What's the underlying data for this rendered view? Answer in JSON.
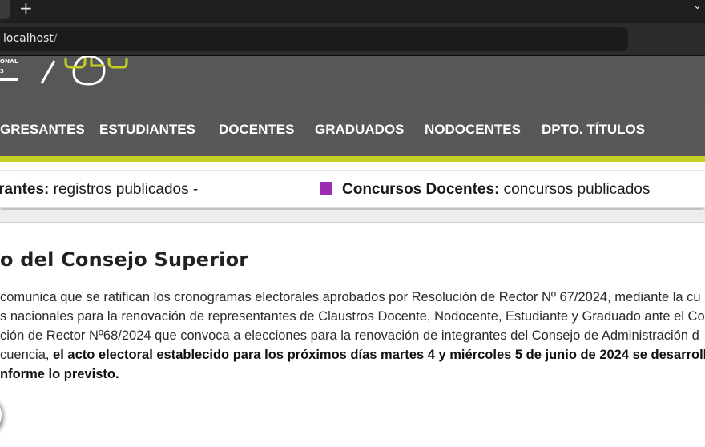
{
  "browser": {
    "new_tab_label": "+",
    "tab_list_label": "⌄",
    "url_host": "localhost",
    "url_path": "/"
  },
  "header": {
    "logo_line1": "ONAL",
    "logo_line2": "3",
    "logo_accent_color": "#c3cf21"
  },
  "nav": {
    "items": [
      {
        "label": "GRESANTES"
      },
      {
        "label": "ESTUDIANTES"
      },
      {
        "label": "DOCENTES"
      },
      {
        "label": "GRADUADOS"
      },
      {
        "label": "NODOCENTES"
      },
      {
        "label": "DPTO. TÍTULOS"
      }
    ],
    "accent_color": "#c3cf21"
  },
  "ticker": {
    "item1_bold": "rantes:",
    "item1_text": " registros publicados -",
    "item2_bold": "Concursos Docentes:",
    "item2_text": " concursos publicados",
    "bullet_color": "#9b2db3"
  },
  "article": {
    "title": "o del Consejo Superior",
    "line1": "comunica que se ratifican los cronogramas electorales aprobados por Resolución de Rector Nº 67/2024, mediante la cu",
    "line2": "s nacionales para la renovación de representantes de Claustros Docente, Nodocente, Estudiante y Graduado ante el Co",
    "line3": "ción de Rector Nº68/2024 que convoca a elecciones para la renovación de integrantes del Consejo de Administración d",
    "line4_plain": "cuencia, ",
    "line4_bold": "el acto electoral establecido para los próximos días martes 4 y miércoles 5 de junio de 2024 se desarroll",
    "line5_bold": "nforme lo previsto."
  }
}
